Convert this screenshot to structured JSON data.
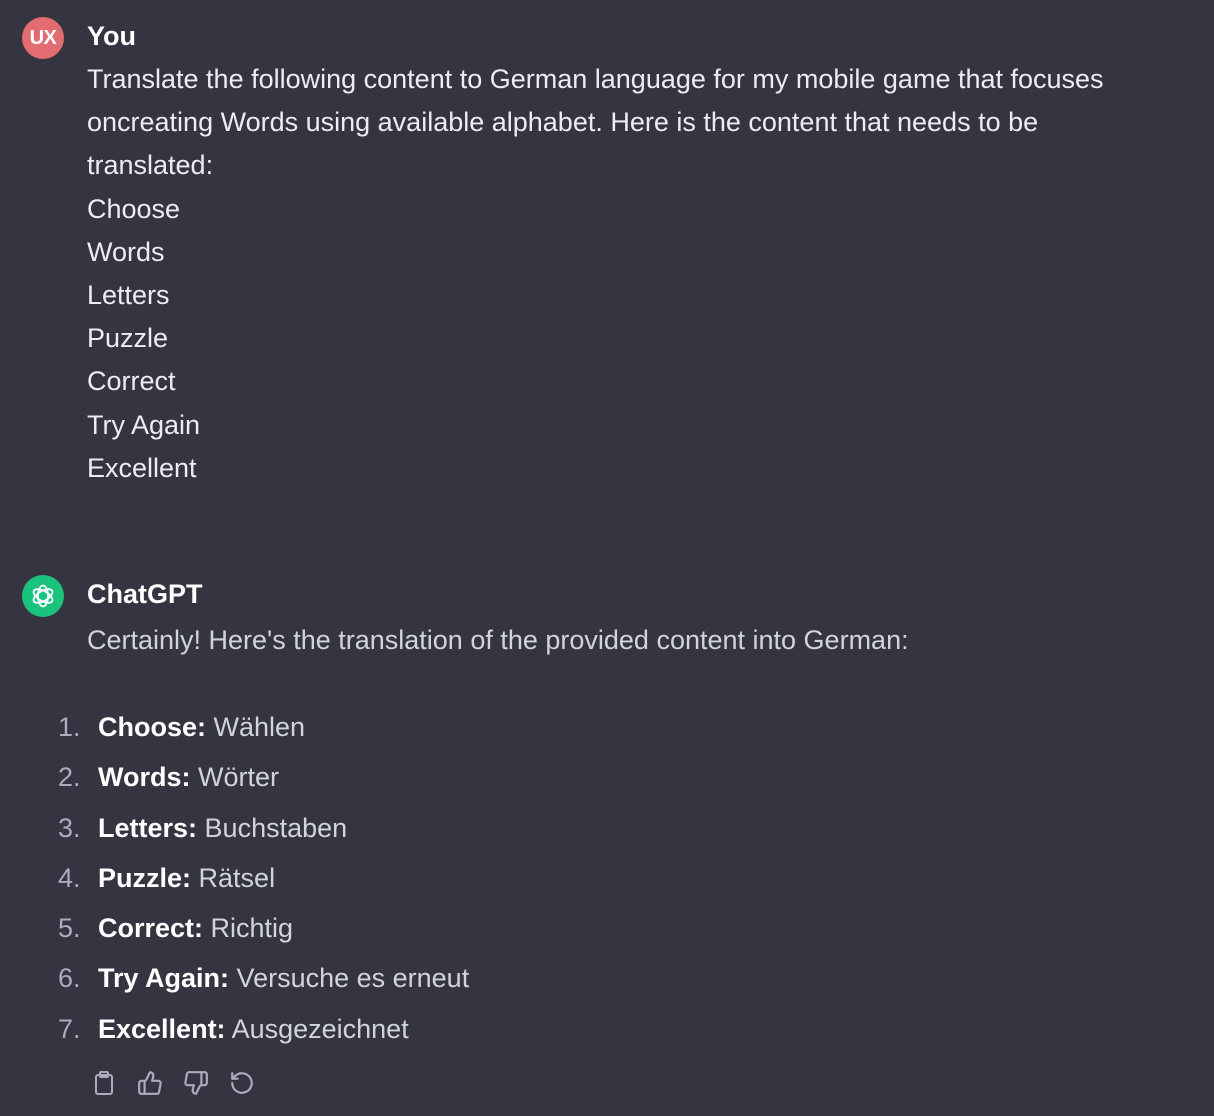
{
  "user_message": {
    "avatar_initials": "UX",
    "author": "You",
    "lines": [
      "Translate the following content to German language for my mobile game that focuses",
      "oncreating Words using available alphabet. Here is the content that needs to be",
      "translated:",
      "Choose",
      "Words",
      "Letters",
      "Puzzle",
      "Correct",
      "Try Again",
      "Excellent"
    ]
  },
  "assistant_message": {
    "author": "ChatGPT",
    "intro": "Certainly! Here's the translation of the provided content into German:",
    "items": [
      {
        "num": "1.",
        "term": "Choose:",
        "translation": "Wählen"
      },
      {
        "num": "2.",
        "term": "Words:",
        "translation": "Wörter"
      },
      {
        "num": "3.",
        "term": "Letters:",
        "translation": "Buchstaben"
      },
      {
        "num": "4.",
        "term": "Puzzle:",
        "translation": "Rätsel"
      },
      {
        "num": "5.",
        "term": "Correct:",
        "translation": "Richtig"
      },
      {
        "num": "6.",
        "term": "Try Again:",
        "translation": "Versuche es erneut"
      },
      {
        "num": "7.",
        "term": "Excellent:",
        "translation": "Ausgezeichnet"
      }
    ]
  },
  "actions": {
    "icons": [
      "clipboard-icon",
      "thumbs-up-icon",
      "thumbs-down-icon",
      "regenerate-icon"
    ]
  },
  "colors": {
    "background": "#343541",
    "user_avatar": "#e36b72",
    "assistant_avatar": "#19c37d",
    "text": "#ececf1"
  }
}
